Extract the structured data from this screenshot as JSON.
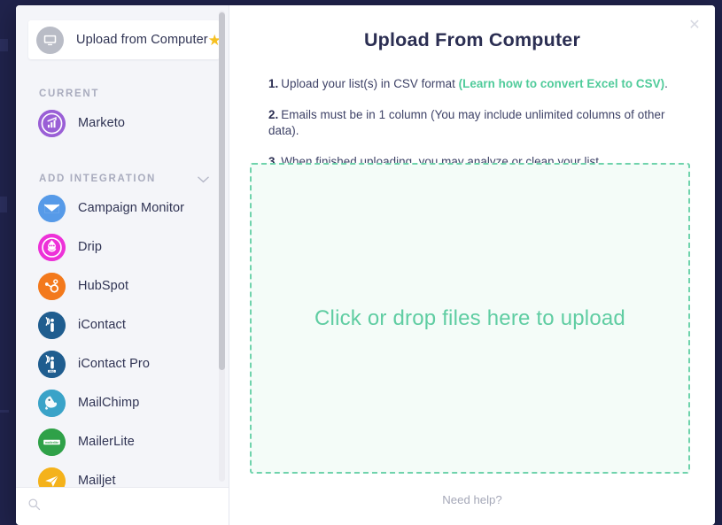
{
  "sidebar": {
    "featured": {
      "label": "Upload from Computer",
      "icon": "monitor-icon",
      "starred": true,
      "star_icon": "star-icon",
      "avatar_color": "#b9bcc6"
    },
    "sections": [
      {
        "id": "current",
        "label": "CURRENT",
        "collapsible": false
      },
      {
        "id": "add-integration",
        "label": "ADD INTEGRATION",
        "collapsible": true,
        "chevron_icon": "chevron-down-icon"
      }
    ],
    "current_items": [
      {
        "label": "Marketo",
        "icon": "marketo-icon",
        "color": "#9a5fd6"
      }
    ],
    "integration_items": [
      {
        "label": "Campaign Monitor",
        "icon": "campaign-monitor-icon",
        "color": "#569ae8"
      },
      {
        "label": "Drip",
        "icon": "drip-icon",
        "color": "#ed31d8"
      },
      {
        "label": "HubSpot",
        "icon": "hubspot-icon",
        "color": "#f3791c"
      },
      {
        "label": "iContact",
        "icon": "icontact-icon",
        "color": "#1f5d8f"
      },
      {
        "label": "iContact Pro",
        "icon": "icontact-pro-icon",
        "color": "#1f5d8f"
      },
      {
        "label": "MailChimp",
        "icon": "mailchimp-icon",
        "color": "#3aa3c8"
      },
      {
        "label": "MailerLite",
        "icon": "mailerlite-icon",
        "color": "#2fa148"
      },
      {
        "label": "Mailjet",
        "icon": "mailjet-icon",
        "color": "#f4b21b"
      }
    ],
    "search": {
      "icon": "search-icon",
      "value": "",
      "placeholder": ""
    },
    "scrollbar": {
      "name": "sidebar-scrollbar"
    }
  },
  "main": {
    "title": "Upload From Computer",
    "close_icon": "close-icon",
    "steps": [
      {
        "num": "1.",
        "text_before": "Upload your list(s) in CSV format ",
        "link": "(Learn how to convert Excel to CSV)",
        "text_after": "."
      },
      {
        "num": "2.",
        "text_before": "Emails must be in 1 column (You may include unlimited columns of other data).",
        "link": "",
        "text_after": ""
      },
      {
        "num": "3.",
        "text_before": "When finished uploading, you may analyze or clean your list.",
        "link": "",
        "text_after": ""
      }
    ],
    "dropzone": {
      "text": "Click or drop files here to upload",
      "border_color": "#6fd3ac",
      "fill_color": "#f4fcf8"
    },
    "need_help": "Need help?"
  },
  "colors": {
    "accent_green": "#5fcda2",
    "title_navy": "#2b2e52",
    "backdrop_navy": "#20234c",
    "star_gold": "#f6c020"
  }
}
